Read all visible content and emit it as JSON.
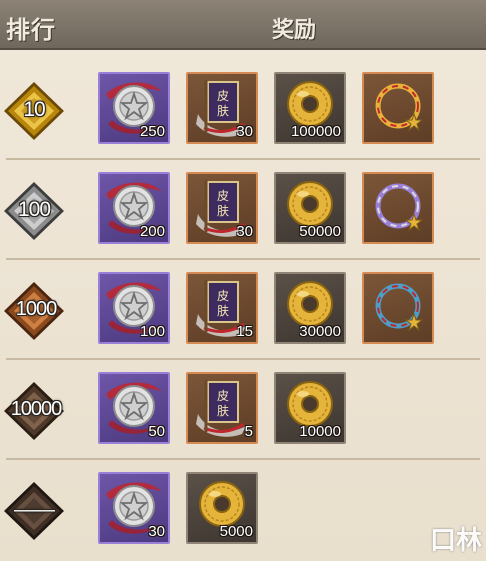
{
  "header": {
    "rank_label": "排行",
    "reward_label": "奖励"
  },
  "rows": [
    {
      "rank": "10",
      "badge": "gold",
      "items": [
        {
          "kind": "silver-coin",
          "qty": "250",
          "frame": "purple"
        },
        {
          "kind": "skin-banner",
          "banner_text": "皮肤",
          "qty": "30",
          "frame": "orange"
        },
        {
          "kind": "gold-coin",
          "qty": "100000",
          "frame": "dark"
        },
        {
          "kind": "ring-gold",
          "qty": "",
          "frame": "orange"
        }
      ]
    },
    {
      "rank": "100",
      "badge": "silver",
      "items": [
        {
          "kind": "silver-coin",
          "qty": "200",
          "frame": "purple"
        },
        {
          "kind": "skin-banner",
          "banner_text": "皮肤",
          "qty": "30",
          "frame": "orange"
        },
        {
          "kind": "gold-coin",
          "qty": "50000",
          "frame": "dark"
        },
        {
          "kind": "ring-purple",
          "qty": "",
          "frame": "orange"
        }
      ]
    },
    {
      "rank": "1000",
      "badge": "bronze",
      "items": [
        {
          "kind": "silver-coin",
          "qty": "100",
          "frame": "purple"
        },
        {
          "kind": "skin-banner",
          "banner_text": "皮肤",
          "qty": "15",
          "frame": "orange"
        },
        {
          "kind": "gold-coin",
          "qty": "30000",
          "frame": "dark"
        },
        {
          "kind": "ring-blue",
          "qty": "",
          "frame": "orange"
        }
      ]
    },
    {
      "rank": "10000",
      "badge": "brown",
      "items": [
        {
          "kind": "silver-coin",
          "qty": "50",
          "frame": "purple"
        },
        {
          "kind": "skin-banner",
          "banner_text": "皮肤",
          "qty": "5",
          "frame": "orange"
        },
        {
          "kind": "gold-coin",
          "qty": "10000",
          "frame": "dark"
        }
      ]
    },
    {
      "rank": "——",
      "badge": "dark",
      "items": [
        {
          "kind": "silver-coin",
          "qty": "30",
          "frame": "purple"
        },
        {
          "kind": "gold-coin",
          "qty": "5000",
          "frame": "dark"
        }
      ]
    }
  ],
  "watermark": "口林",
  "colors": {
    "badge_gold": "#d9a520",
    "badge_silver": "#9b9b9b",
    "badge_bronze": "#a4622f",
    "badge_brown": "#5e4534",
    "badge_dark": "#4a3a2e",
    "frame_purple": "#9a7fd8",
    "frame_orange": "#d48a52",
    "frame_dark": "#8f8476"
  }
}
